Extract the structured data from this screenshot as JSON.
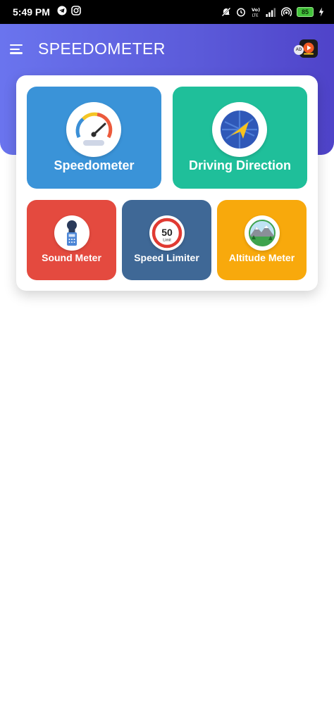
{
  "status_bar": {
    "time": "5:49 PM",
    "battery_level": "85",
    "left_icons": [
      "telegram-icon",
      "instagram-icon"
    ],
    "right_icons": [
      "mute-icon",
      "alarm-icon",
      "volte-icon",
      "signal-icon",
      "hotspot-icon",
      "battery-icon",
      "charging-icon"
    ]
  },
  "header": {
    "title": "SPEEDOMETER",
    "ad_badge": "AD",
    "colors": {
      "gradient_start": "#6a74ee",
      "gradient_end": "#4f43c9"
    }
  },
  "tiles": [
    {
      "label": "Speedometer",
      "color": "#3a93d8",
      "icon": "speedometer-gauge-icon"
    },
    {
      "label": "Driving Direction",
      "color": "#1fbf9a",
      "icon": "navigation-compass-icon"
    },
    {
      "label": "Sound Meter",
      "color": "#e44a3f",
      "icon": "sound-meter-icon"
    },
    {
      "label": "Speed Limiter",
      "color": "#3f6896",
      "icon": "speed-limit-sign-icon",
      "sign_value": "50",
      "sign_caption": "Limit"
    },
    {
      "label": "Altitude Meter",
      "color": "#f8a90c",
      "icon": "mountain-icon"
    }
  ]
}
